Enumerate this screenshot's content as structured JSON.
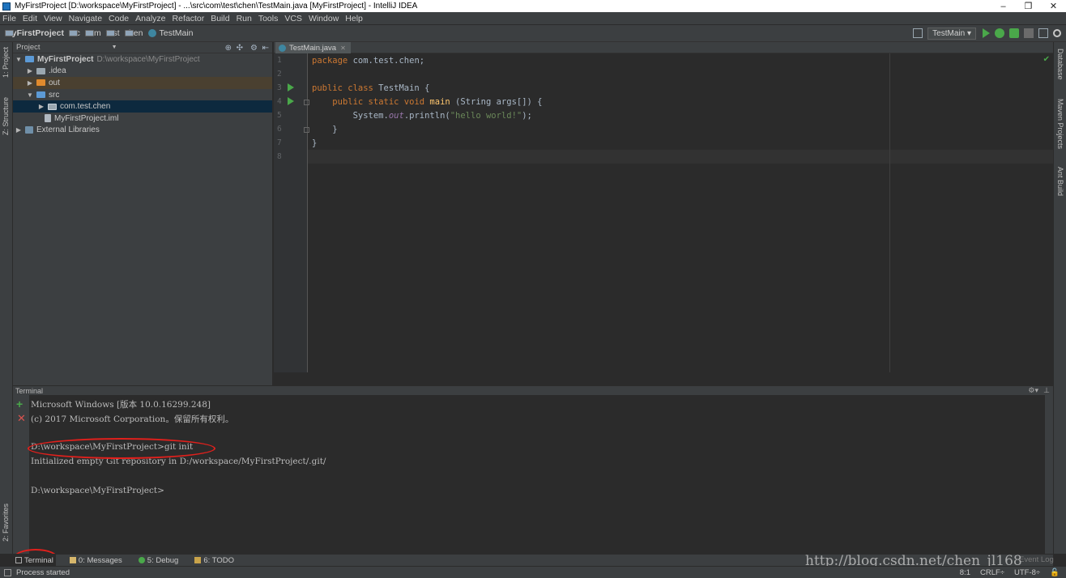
{
  "window": {
    "title": "MyFirstProject [D:\\workspace\\MyFirstProject] - ...\\src\\com\\test\\chen\\TestMain.java [MyFirstProject] - IntelliJ IDEA"
  },
  "menu": [
    "File",
    "Edit",
    "View",
    "Navigate",
    "Code",
    "Analyze",
    "Refactor",
    "Build",
    "Run",
    "Tools",
    "VCS",
    "Window",
    "Help"
  ],
  "breadcrumbs": [
    "MyFirstProject",
    "src",
    "com",
    "test",
    "chen",
    "TestMain"
  ],
  "run_config": "TestMain",
  "left_stripe": {
    "project": "1: Project",
    "structure": "Z: Structure",
    "favorites": "2: Favorites"
  },
  "right_stripe": {
    "database": "Database",
    "maven": "Maven Projects",
    "ant": "Ant Build"
  },
  "project_panel": {
    "title": "Project",
    "tree": [
      {
        "label": "MyFirstProject",
        "path": "D:\\workspace\\MyFirstProject",
        "arrow": "▼"
      },
      {
        "label": ".idea",
        "arrow": "▶"
      },
      {
        "label": "out",
        "arrow": "▶"
      },
      {
        "label": "src",
        "arrow": "▼"
      },
      {
        "label": "com.test.chen",
        "arrow": "▶"
      },
      {
        "label": "MyFirstProject.iml",
        "arrow": ""
      },
      {
        "label": "External Libraries",
        "arrow": "▶"
      }
    ]
  },
  "editor": {
    "tab": "TestMain.java",
    "line_numbers": [
      "1",
      "2",
      "3",
      "4",
      "5",
      "6",
      "7",
      "8"
    ],
    "code": {
      "l1_kw": "package",
      "l1_rest": " com.test.chen;",
      "l3_kw": "public class",
      "l3_rest": " TestMain {",
      "l4_kw": "public static void",
      "l4_fn": "main",
      "l4_rest": " (String args[]) {",
      "l5_a": "System.",
      "l5_fld": "out",
      "l5_b": ".println(",
      "l5_str": "\"hello world!\"",
      "l5_c": ");",
      "l6": "}",
      "l7": "}"
    }
  },
  "terminal": {
    "title": "Terminal",
    "lines": [
      "Microsoft Windows [版本 10.0.16299.248]",
      "(c) 2017 Microsoft Corporation。保留所有权利。",
      "",
      "D:\\workspace\\MyFirstProject>git init",
      "Initialized empty Git repository in D:/workspace/MyFirstProject/.git/",
      "",
      "D:\\workspace\\MyFirstProject>"
    ]
  },
  "bottom_tabs": [
    "Terminal",
    "0: Messages",
    "5: Debug",
    "6: TODO"
  ],
  "event_log": "Event Log",
  "watermark": "http://blog.csdn.net/chen_jl168",
  "status": {
    "message": "Process started",
    "position": "8:1",
    "line_sep": "CRLF÷",
    "encoding": "UTF-8÷"
  },
  "colors": {
    "accent_green": "#4aa84a",
    "annotation_red": "#e0201c",
    "selection": "#0d293e"
  }
}
